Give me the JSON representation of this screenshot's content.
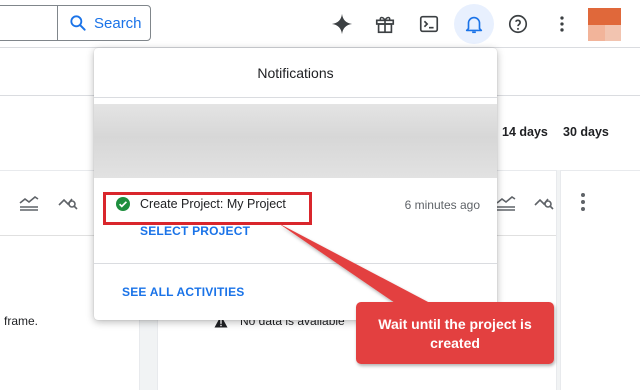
{
  "topbar": {
    "search_label": "Search",
    "icons": [
      "search-icon",
      "gemini-spark-icon",
      "gift-icon",
      "cloud-shell-icon",
      "bell-icon",
      "help-icon",
      "more-vert-icon"
    ]
  },
  "page": {
    "range_options": [
      "14 days",
      "30 days"
    ],
    "left_card_text": "frame.",
    "right_card_text": "No data is available"
  },
  "notifications": {
    "title": "Notifications",
    "item": {
      "status": "success",
      "title": "Create Project: My Project",
      "time": "6 minutes ago",
      "action": "SELECT PROJECT"
    },
    "see_all": "SEE ALL ACTIVITIES"
  },
  "callout": {
    "text": "Wait until the project is created",
    "color": "#e34040"
  },
  "colors": {
    "accent": "#1a73e8",
    "highlight": "#d9262c",
    "success": "#1e8e3e"
  }
}
